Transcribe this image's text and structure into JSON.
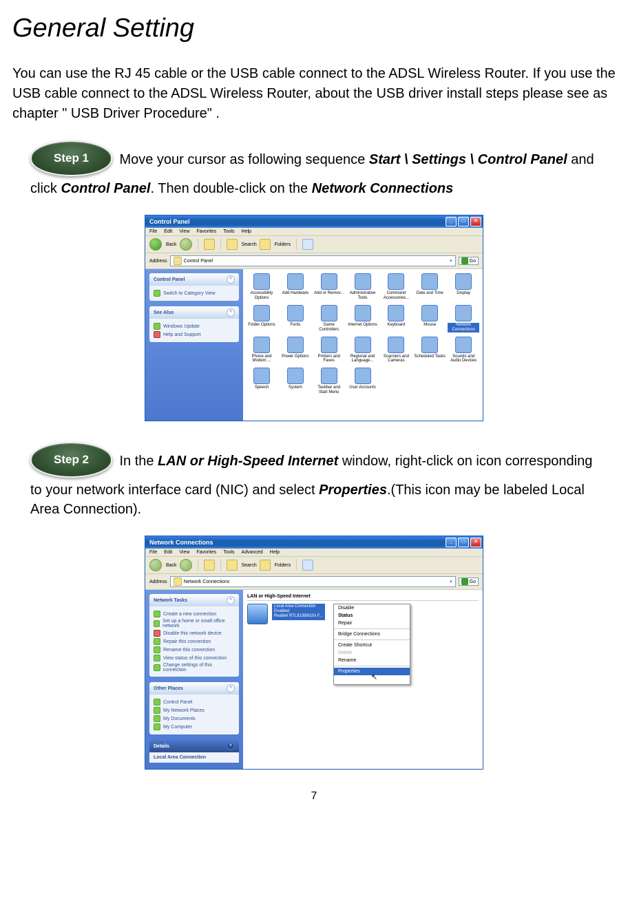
{
  "title": "General Setting",
  "intro": "You can use the RJ 45 cable or the USB cable connect to the ADSL Wireless Router. If you use the USB cable connect to the ADSL Wireless Router, about the USB driver install steps please see as chapter \" USB Driver Procedure\" .",
  "step1": {
    "badge": "Step 1",
    "lead": " Move your cursor as following sequence ",
    "path": "Start \\ Settings \\ Control Panel",
    "mid": " and click ",
    "cp": "Control Panel",
    "mid2": ". Then double-click on the ",
    "nc": "Network Connections"
  },
  "step2": {
    "badge": "Step 2",
    "lead": " In the ",
    "lan": "LAN or High-Speed Internet",
    "mid": " window, right-click on icon corresponding to your network interface card (NIC) and select ",
    "prop": "Properties",
    "tail": ".(This icon may be labeled Local Area Connection)."
  },
  "cp_window": {
    "title": "Control Panel",
    "menus": [
      "File",
      "Edit",
      "View",
      "Favorites",
      "Tools",
      "Help"
    ],
    "toolbar": {
      "back": "Back",
      "search": "Search",
      "folders": "Folders"
    },
    "address_label": "Address",
    "address_value": "Control Panel",
    "go": "Go",
    "side1_title": "Control Panel",
    "side1_link": "Switch to Category View",
    "side2_title": "See Also",
    "side2_links": [
      "Windows Update",
      "Help and Support"
    ],
    "icons": [
      "Accessibility Options",
      "Add Hardware",
      "Add or Remov...",
      "Administrative Tools",
      "Command Accessories...",
      "Date and Time",
      "Display",
      "Folder Options",
      "Fonts",
      "Game Controllers",
      "Internet Options",
      "Keyboard",
      "Mouse",
      "Network Connections",
      "Phone and Modem ...",
      "Power Options",
      "Printers and Faxes",
      "Regional and Language...",
      "Scanners and Cameras",
      "Scheduled Tasks",
      "Sounds and Audio Devices",
      "Speech",
      "System",
      "Taskbar and Start Menu",
      "User Accounts"
    ]
  },
  "nc_window": {
    "title": "Network Connections",
    "menus": [
      "File",
      "Edit",
      "View",
      "Favorites",
      "Tools",
      "Advanced",
      "Help"
    ],
    "toolbar": {
      "back": "Back",
      "search": "Search",
      "folders": "Folders"
    },
    "address_label": "Address",
    "address_value": "Network Connections",
    "go": "Go",
    "tasks_title": "Network Tasks",
    "tasks": [
      "Create a new connection",
      "Set up a home or small office network",
      "Disable this network device",
      "Repair this connection",
      "Rename this connection",
      "View status of this connection",
      "Change settings of this connection"
    ],
    "other_title": "Other Places",
    "other": [
      "Control Panel",
      "My Network Places",
      "My Documents",
      "My Computer"
    ],
    "details_title": "Details",
    "details_value": "Local Area Connection",
    "section": "LAN or High-Speed Internet",
    "conn_name": "Local Area Connection",
    "conn_status": "Enabled",
    "conn_device": "Realtek RTL8139/810x F...",
    "context": {
      "disable": "Disable",
      "status": "Status",
      "repair": "Repair",
      "bridge": "Bridge Connections",
      "shortcut": "Create Shortcut",
      "delete": "Delete",
      "rename": "Rename",
      "properties": "Properties"
    }
  },
  "page_number": "7"
}
